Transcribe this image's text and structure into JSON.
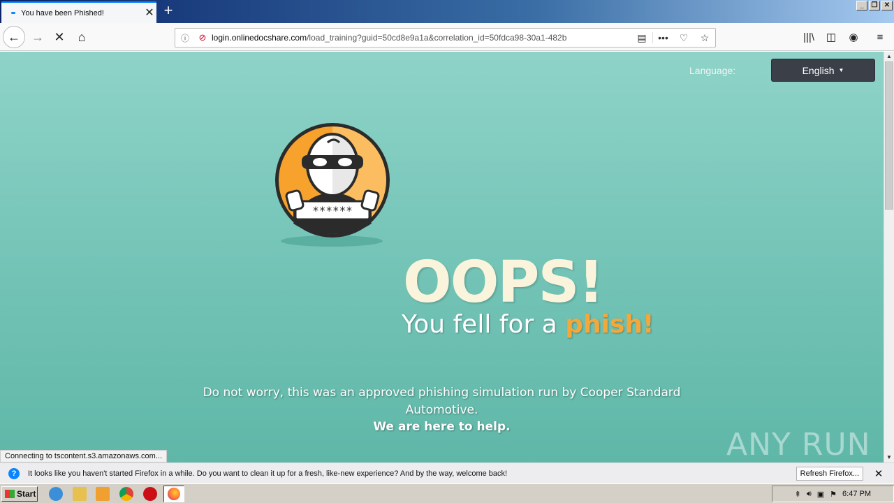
{
  "browser": {
    "tab": {
      "title": "You have been Phished!"
    },
    "url": {
      "host": "login.onlinedocshare.com",
      "path": "/load_training?guid=50cd8e9a1a&correlation_id=50fdca98-30a1-482b"
    },
    "status_text": "Connecting to tscontent.s3.amazonaws.com...",
    "notification": {
      "text": "It looks like you haven't started Firefox in a while. Do you want to clean it up for a fresh, like-new experience? And by the way, welcome back!",
      "button": "Refresh Firefox..."
    }
  },
  "page": {
    "language_label": "Language:",
    "language_value": "English",
    "mascot_caption": "******",
    "headline": "OOPS!",
    "subline_prefix": "You fell for a ",
    "subline_emph": "phish!",
    "message": "Do not worry, this was an approved phishing simulation run by Cooper Standard Automotive.",
    "help": "We are here to help.",
    "watermark": "ANY RUN"
  },
  "taskbar": {
    "start": "Start",
    "clock": "6:47 PM"
  },
  "colors": {
    "page_top": "#8fd3c8",
    "page_bottom": "#5fb7a8",
    "headline": "#fbf4dc",
    "phish_accent": "#f4a83a",
    "lang_button": "#3a3f48"
  }
}
